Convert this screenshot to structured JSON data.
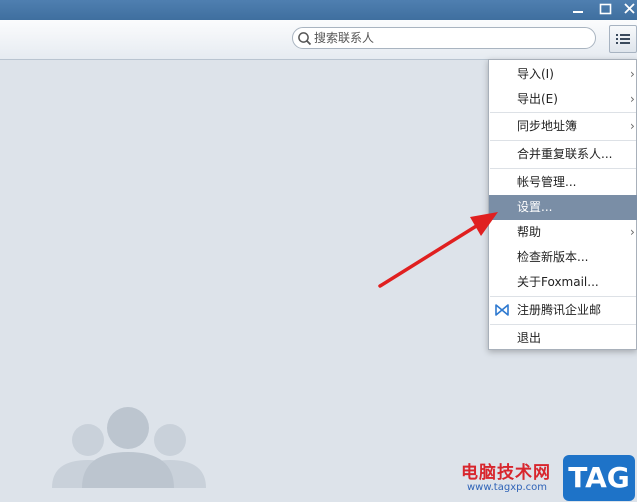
{
  "window": {
    "minimize_icon": "minimize-icon",
    "maximize_icon": "maximize-icon",
    "close_icon": "close-icon"
  },
  "search": {
    "placeholder": "搜索联系人",
    "icon": "search-icon"
  },
  "menu_button": {
    "icon": "list-menu-icon"
  },
  "menu": {
    "items": [
      {
        "label": "导入(I)",
        "has_submenu": true
      },
      {
        "label": "导出(E)",
        "has_submenu": true
      },
      {
        "label": "同步地址簿",
        "has_submenu": true
      },
      {
        "label": "合并重复联系人...",
        "has_submenu": false
      },
      {
        "label": "帐号管理...",
        "has_submenu": false
      },
      {
        "label": "设置...",
        "has_submenu": false,
        "highlighted": true
      },
      {
        "label": "帮助",
        "has_submenu": true
      },
      {
        "label": "检查新版本...",
        "has_submenu": false
      },
      {
        "label": "关于Foxmail...",
        "has_submenu": false
      },
      {
        "label": "注册腾讯企业邮",
        "has_submenu": false,
        "icon": "tencent-mail-icon"
      },
      {
        "label": "退出",
        "has_submenu": false
      }
    ]
  },
  "watermark": {
    "text": "电脑技术网",
    "url": "www.tagxp.com",
    "logo": "TAG"
  },
  "colors": {
    "titlebar": "#4a7aab",
    "background": "#dde3ea",
    "highlight": "#7a8ea6",
    "arrow": "#e02020"
  }
}
